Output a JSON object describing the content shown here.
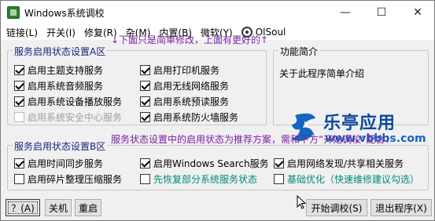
{
  "window": {
    "title": "Windows系统调校",
    "controls": {
      "minimize": "—",
      "maximize": "☐",
      "close": "✕"
    }
  },
  "menu": {
    "items": [
      "链接(L)",
      "开关(I)",
      "修复(R)",
      "杂(M)",
      "内置(B)",
      "微软(Y)",
      "OlSoul"
    ]
  },
  "hint_top": "↓下面只是简单修改，上面有更好的↑",
  "group1": {
    "title": "服务启用状态设置A区",
    "items": [
      {
        "label": "启用主题支持服务",
        "checked": true,
        "disabled": false
      },
      {
        "label": "启用系统音频服务",
        "checked": true,
        "disabled": false
      },
      {
        "label": "启用系统设备播放服务",
        "checked": true,
        "disabled": false
      },
      {
        "label": "启用系统安全中心服务",
        "checked": false,
        "disabled": true
      },
      {
        "label": "启用打印机服务",
        "checked": true,
        "disabled": false
      },
      {
        "label": "启用无线网络服务",
        "checked": true,
        "disabled": false
      },
      {
        "label": "启用系统预读服务",
        "checked": true,
        "disabled": false
      },
      {
        "label": "启用系统防火墙服务",
        "checked": true,
        "disabled": false
      }
    ]
  },
  "feature": {
    "title": "功能简介",
    "description": "关于此程序简单介绍"
  },
  "logo": {
    "name": "乐亭应用",
    "url": "www.vbbbs.com"
  },
  "hint_middle": "服务状态设置中的启用状态为推荐方案，需和下方“开始调校”配合！",
  "group2": {
    "title": "服务启用状态设置B区",
    "items": [
      {
        "label": "启用时间同步服务",
        "checked": true,
        "style": "normal"
      },
      {
        "label": "启用碎片整理压缩服务",
        "checked": false,
        "style": "normal"
      },
      {
        "label": "启用Windows Search服务",
        "checked": true,
        "style": "normal"
      },
      {
        "label": "先恢复部分系统服务状态",
        "checked": false,
        "style": "teal"
      },
      {
        "label": "启用网络发现/共享相关服务",
        "checked": true,
        "style": "normal"
      },
      {
        "label": "基础优化（快速维修建议勾选）",
        "checked": false,
        "style": "teal"
      }
    ]
  },
  "buttons": {
    "help": "？(A)",
    "shutdown": "关机",
    "restart": "重启",
    "start_tune": "开始调校(S)",
    "exit": "退出程序(X)"
  },
  "colors": {
    "hint": "#7a1fa2",
    "group_title": "#1a237e",
    "teal": "#00897b",
    "logo_blue": "#0d47a1"
  }
}
